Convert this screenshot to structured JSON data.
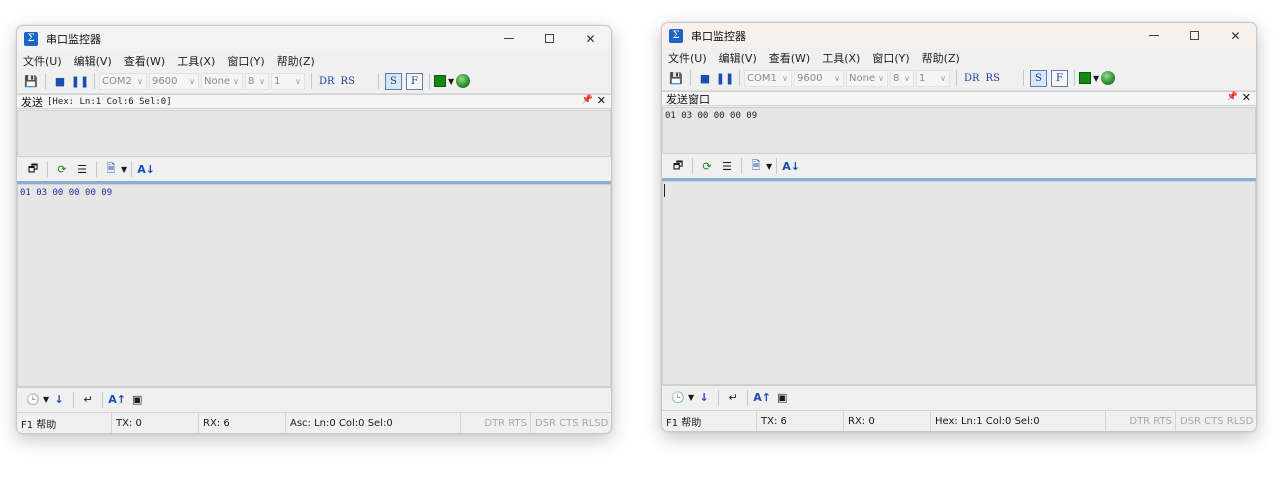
{
  "windows": [
    {
      "title": "串口监控器",
      "menus": [
        "文件(U)",
        "编辑(V)",
        "查看(W)",
        "工具(X)",
        "窗口(Y)",
        "帮助(Z)"
      ],
      "toolbar": {
        "port": "COM2",
        "baud": "9600",
        "parity": "None",
        "data_bits": "8",
        "stop_bits": "1",
        "dr": "DR",
        "rs": "RS",
        "s_btn": "S",
        "f_btn": "F"
      },
      "panel_title": "发送",
      "panel_hint": "[Hex: Ln:1 Col:6 Sel:0]",
      "top_text": "",
      "bottom_text": "01 03 00 00 00 09",
      "status": {
        "help": "F1 帮助",
        "tx": "TX: 0",
        "rx": "RX: 6",
        "pos": "Asc: Ln:0  Col:0  Sel:0",
        "dtr": "DTR RTS",
        "dsr": "DSR CTS RLSD"
      }
    },
    {
      "title": "串口监控器",
      "menus": [
        "文件(U)",
        "编辑(V)",
        "查看(W)",
        "工具(X)",
        "窗口(Y)",
        "帮助(Z)"
      ],
      "toolbar": {
        "port": "COM1",
        "baud": "9600",
        "parity": "None",
        "data_bits": "8",
        "stop_bits": "1",
        "dr": "DR",
        "rs": "RS",
        "s_btn": "S",
        "f_btn": "F"
      },
      "panel_title": "发送窗口",
      "panel_hint": "",
      "top_text": "01 03 00 00 00 09",
      "bottom_text": "",
      "status": {
        "help": "F1 帮助",
        "tx": "TX: 6",
        "rx": "RX: 0",
        "pos": "Hex: Ln:1  Col:0  Sel:0",
        "dtr": "DTR RTS",
        "dsr": "DSR CTS RLSD"
      }
    }
  ],
  "colors": {
    "accent_blue": "#1b63c6",
    "data_text": "#1c2fa0",
    "led_green": "#118a11"
  },
  "icons": [
    "app-icon",
    "save-icon",
    "stop-icon",
    "pause-icon",
    "green-led-icon",
    "globe-icon",
    "pin-icon",
    "close-icon",
    "clock-icon",
    "arrow-down-icon",
    "enter-icon",
    "font-icon",
    "window-icon"
  ]
}
